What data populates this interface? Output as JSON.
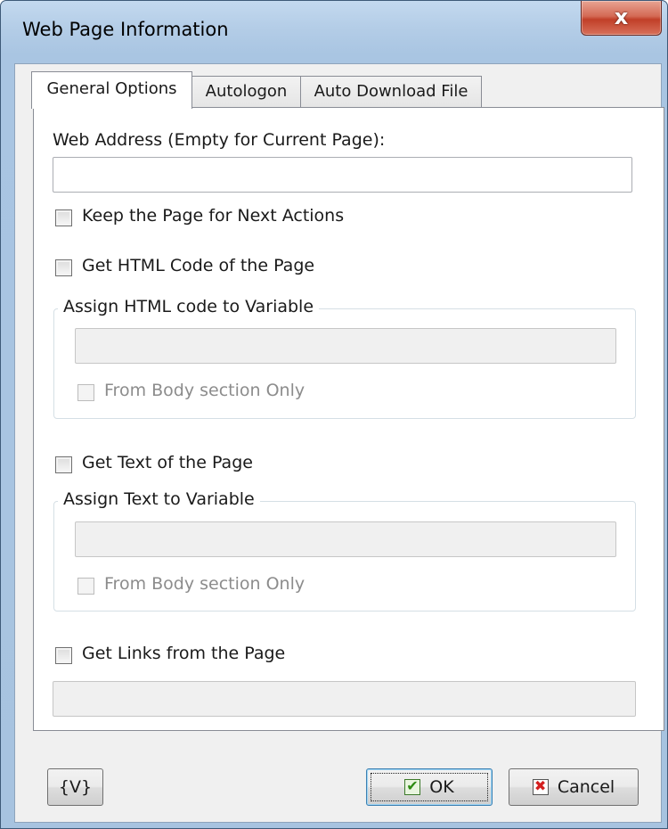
{
  "window": {
    "title": "Web Page Information",
    "close_glyph": "x"
  },
  "tabs": [
    {
      "label": "General Options"
    },
    {
      "label": "Autologon"
    },
    {
      "label": "Auto Download File"
    }
  ],
  "general": {
    "web_address_label": "Web Address (Empty for Current Page):",
    "web_address_value": "",
    "keep_page_label": "Keep the Page for Next Actions",
    "get_html_label": "Get HTML Code of the Page",
    "html_group_title": "Assign HTML code to Variable",
    "html_from_body_label": "From Body section Only",
    "get_text_label": "Get Text of the Page",
    "text_group_title": "Assign Text to Variable",
    "text_from_body_label": "From Body section Only",
    "get_links_label": "Get Links from the Page"
  },
  "buttons": {
    "variables": "{V}",
    "ok": "OK",
    "cancel": "Cancel"
  }
}
